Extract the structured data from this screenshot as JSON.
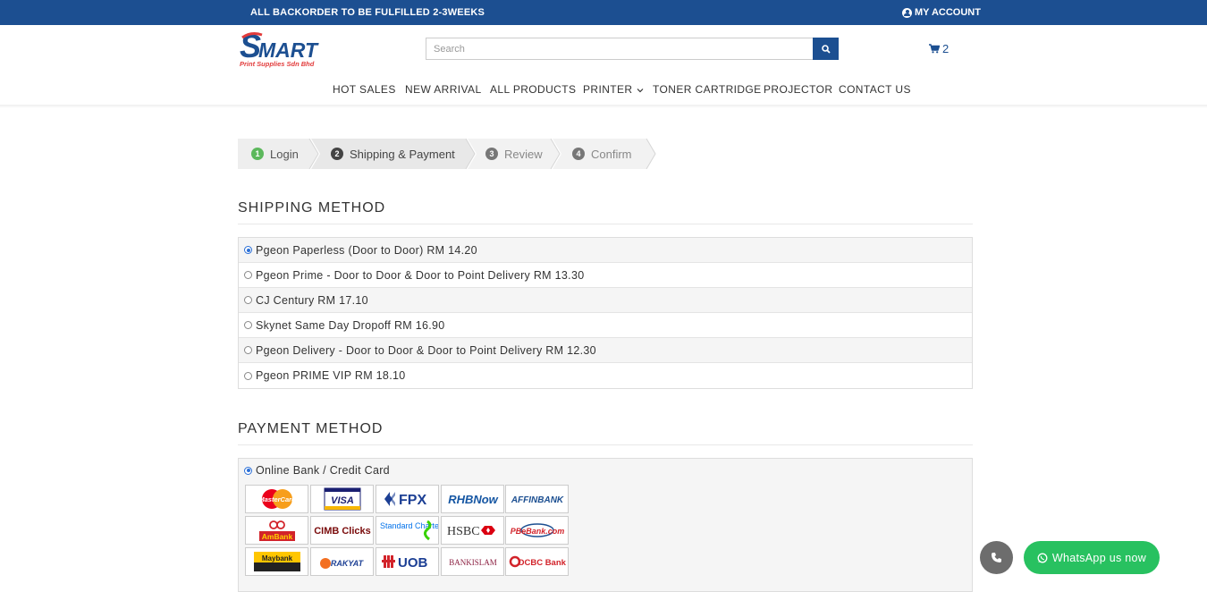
{
  "topbar": {
    "notice": "ALL BACKORDER TO BE FULFILLED 2-3WEEKS",
    "account_label": "MY ACCOUNT"
  },
  "logo": {
    "wordmark": "SMART",
    "tagline": "Print Supplies Sdn Bhd"
  },
  "search": {
    "placeholder": "Search"
  },
  "cart": {
    "count": "2"
  },
  "nav": {
    "items": [
      "HOT SALES",
      "NEW ARRIVAL",
      "ALL PRODUCTS",
      "PRINTER",
      "TONER CARTRIDGE",
      "PROJECTOR",
      "CONTACT US"
    ]
  },
  "steps": [
    {
      "num": "1",
      "label": "Login",
      "state": "done"
    },
    {
      "num": "2",
      "label": "Shipping & Payment",
      "state": "current"
    },
    {
      "num": "3",
      "label": "Review",
      "state": "pending"
    },
    {
      "num": "4",
      "label": "Confirm",
      "state": "pending"
    }
  ],
  "shipping": {
    "title": "SHIPPING METHOD",
    "options": [
      {
        "label": "Pgeon Paperless (Door to Door) RM 14.20",
        "selected": true
      },
      {
        "label": "Pgeon Prime - Door to Door & Door to Point Delivery RM 13.30",
        "selected": false
      },
      {
        "label": "CJ Century RM 17.10",
        "selected": false
      },
      {
        "label": "Skynet Same Day Dropoff RM 16.90",
        "selected": false
      },
      {
        "label": "Pgeon Delivery - Door to Door & Door to Point Delivery RM 12.30",
        "selected": false
      },
      {
        "label": "Pgeon PRIME VIP RM 18.10",
        "selected": false
      }
    ]
  },
  "payment": {
    "title": "PAYMENT METHOD",
    "option_label": "Online Bank / Credit Card",
    "banks": [
      "MasterCard",
      "VISA",
      "FPX",
      "RHBNow",
      "AFFINBANK",
      "AmBank",
      "CIMB Clicks",
      "Standard Chartered",
      "HSBC",
      "PBeBank.com",
      "Maybank",
      "RAKYAT",
      "UOB",
      "BANKISLAM",
      "OCBC Bank"
    ]
  },
  "widgets": {
    "whatsapp_label": "WhatsApp us now"
  },
  "colors": {
    "brand_blue": "#1c4f91",
    "whatsapp_green": "#28c160",
    "step_done_green": "#5cb85c"
  }
}
